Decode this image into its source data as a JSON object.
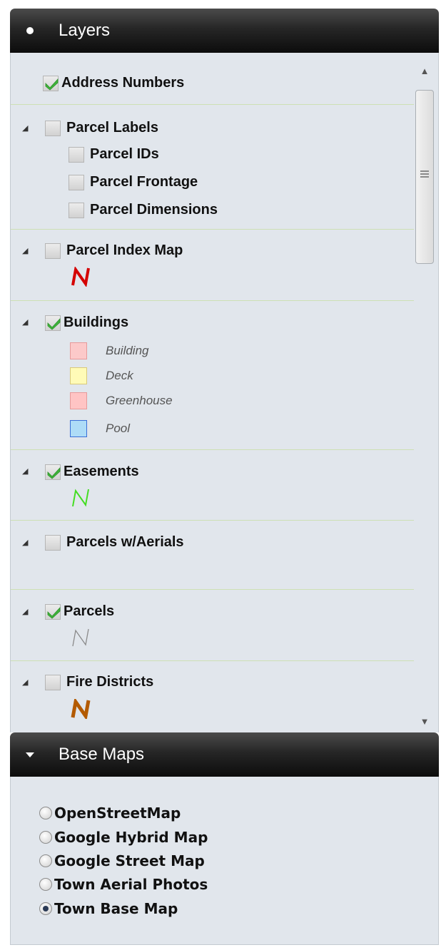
{
  "layers_panel": {
    "title": "Layers",
    "icon": "bullet-icon",
    "items": [
      {
        "label": "Address Numbers",
        "checked": true,
        "expandable": false
      },
      {
        "label": "Parcel Labels",
        "checked": false,
        "expandable": true,
        "children": [
          {
            "label": "Parcel IDs",
            "checked": false
          },
          {
            "label": "Parcel Frontage",
            "checked": false
          },
          {
            "label": "Parcel Dimensions",
            "checked": false
          }
        ]
      },
      {
        "label": "Parcel Index Map",
        "checked": false,
        "expandable": true,
        "symbol": "N",
        "symbol_color": "#d40000"
      },
      {
        "label": "Buildings",
        "checked": true,
        "expandable": true,
        "legend": [
          {
            "label": "Building",
            "fill": "#fcc9c9",
            "stroke": "#e79a9a"
          },
          {
            "label": "Deck",
            "fill": "#fffbb7",
            "stroke": "#d9c97a"
          },
          {
            "label": "Greenhouse",
            "fill": "#ffc4c4",
            "stroke": "#e79a9a"
          },
          {
            "label": "Pool",
            "fill": "#aedcf7",
            "stroke": "#3a6fd8"
          }
        ]
      },
      {
        "label": "Easements",
        "checked": true,
        "expandable": true,
        "symbol": "N",
        "symbol_color": "#44dd22"
      },
      {
        "label": "Parcels w/Aerials",
        "checked": false,
        "expandable": true
      },
      {
        "label": "Parcels",
        "checked": true,
        "expandable": true,
        "symbol": "N",
        "symbol_color": "#8a8a8a"
      },
      {
        "label": "Fire Districts",
        "checked": false,
        "expandable": true,
        "symbol": "N",
        "symbol_color": "#b35a00"
      }
    ]
  },
  "basemaps_panel": {
    "title": "Base Maps",
    "icon": "triangle-down-icon",
    "options": [
      {
        "label": "OpenStreetMap",
        "selected": false
      },
      {
        "label": "Google Hybrid Map",
        "selected": false
      },
      {
        "label": "Google Street Map",
        "selected": false
      },
      {
        "label": "Town Aerial Photos",
        "selected": false
      },
      {
        "label": "Town Base Map",
        "selected": true
      }
    ]
  },
  "colors": {
    "header_bg": "#111111",
    "panel_bg": "#e1e6ec",
    "divider": "#cde0b4",
    "check_green": "#3fb43a"
  }
}
